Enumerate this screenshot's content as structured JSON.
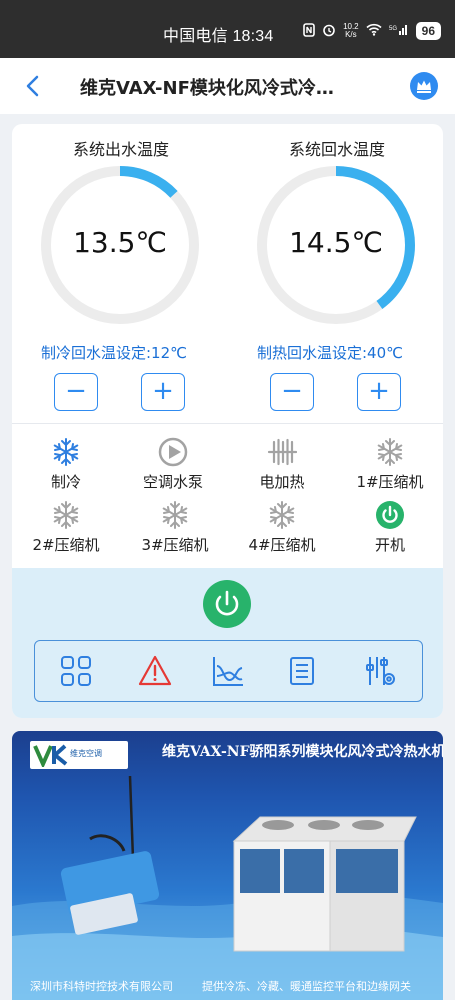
{
  "status_bar": {
    "time": "中国电信 18:34",
    "speed_top": "10.2",
    "speed_bottom": "K/s",
    "battery": "96"
  },
  "nav": {
    "title": "维克VAX-NF模块化风冷式冷…"
  },
  "gauges": [
    {
      "title": "系统出水温度",
      "value": "13.5℃",
      "fill_fraction": 0.13,
      "color": "#3ab0ef"
    },
    {
      "title": "系统回水温度",
      "value": "14.5℃",
      "fill_fraction": 0.4,
      "color": "#3ab0ef"
    }
  ],
  "setpoints": {
    "cool": "制冷回水温设定:12℃",
    "heat": "制热回水温设定:40℃",
    "minus": "−",
    "plus": "+"
  },
  "status_items": [
    {
      "label": "制冷",
      "icon": "snowflake-icon",
      "active": true
    },
    {
      "label": "空调水泵",
      "icon": "pump-icon",
      "active": false
    },
    {
      "label": "电加热",
      "icon": "heater-icon",
      "active": false
    },
    {
      "label": "1#压缩机",
      "icon": "snowflake-icon",
      "active": false
    },
    {
      "label": "2#压缩机",
      "icon": "snowflake-icon",
      "active": false
    },
    {
      "label": "3#压缩机",
      "icon": "snowflake-icon",
      "active": false
    },
    {
      "label": "4#压缩机",
      "icon": "snowflake-icon",
      "active": false
    },
    {
      "label": "开机",
      "icon": "power-icon",
      "active": true
    }
  ],
  "toolbar": [
    "grid-icon",
    "alarm-icon",
    "chart-icon",
    "list-icon",
    "settings-icon"
  ],
  "banner": {
    "title": "维克VAX-NF骄阳系列模块化风冷式冷热水机组",
    "logo_text": "维克空调",
    "footer_left": "深圳市科特时控技术有限公司",
    "footer_right": "提供冷冻、冷藏、暖通监控平台和边缘网关"
  },
  "colors": {
    "accent": "#2f8bf0",
    "active_blue": "#2f7fe0",
    "inactive_gray": "#a3a3a3",
    "power_green": "#28b36b",
    "alarm_red": "#e53935"
  }
}
